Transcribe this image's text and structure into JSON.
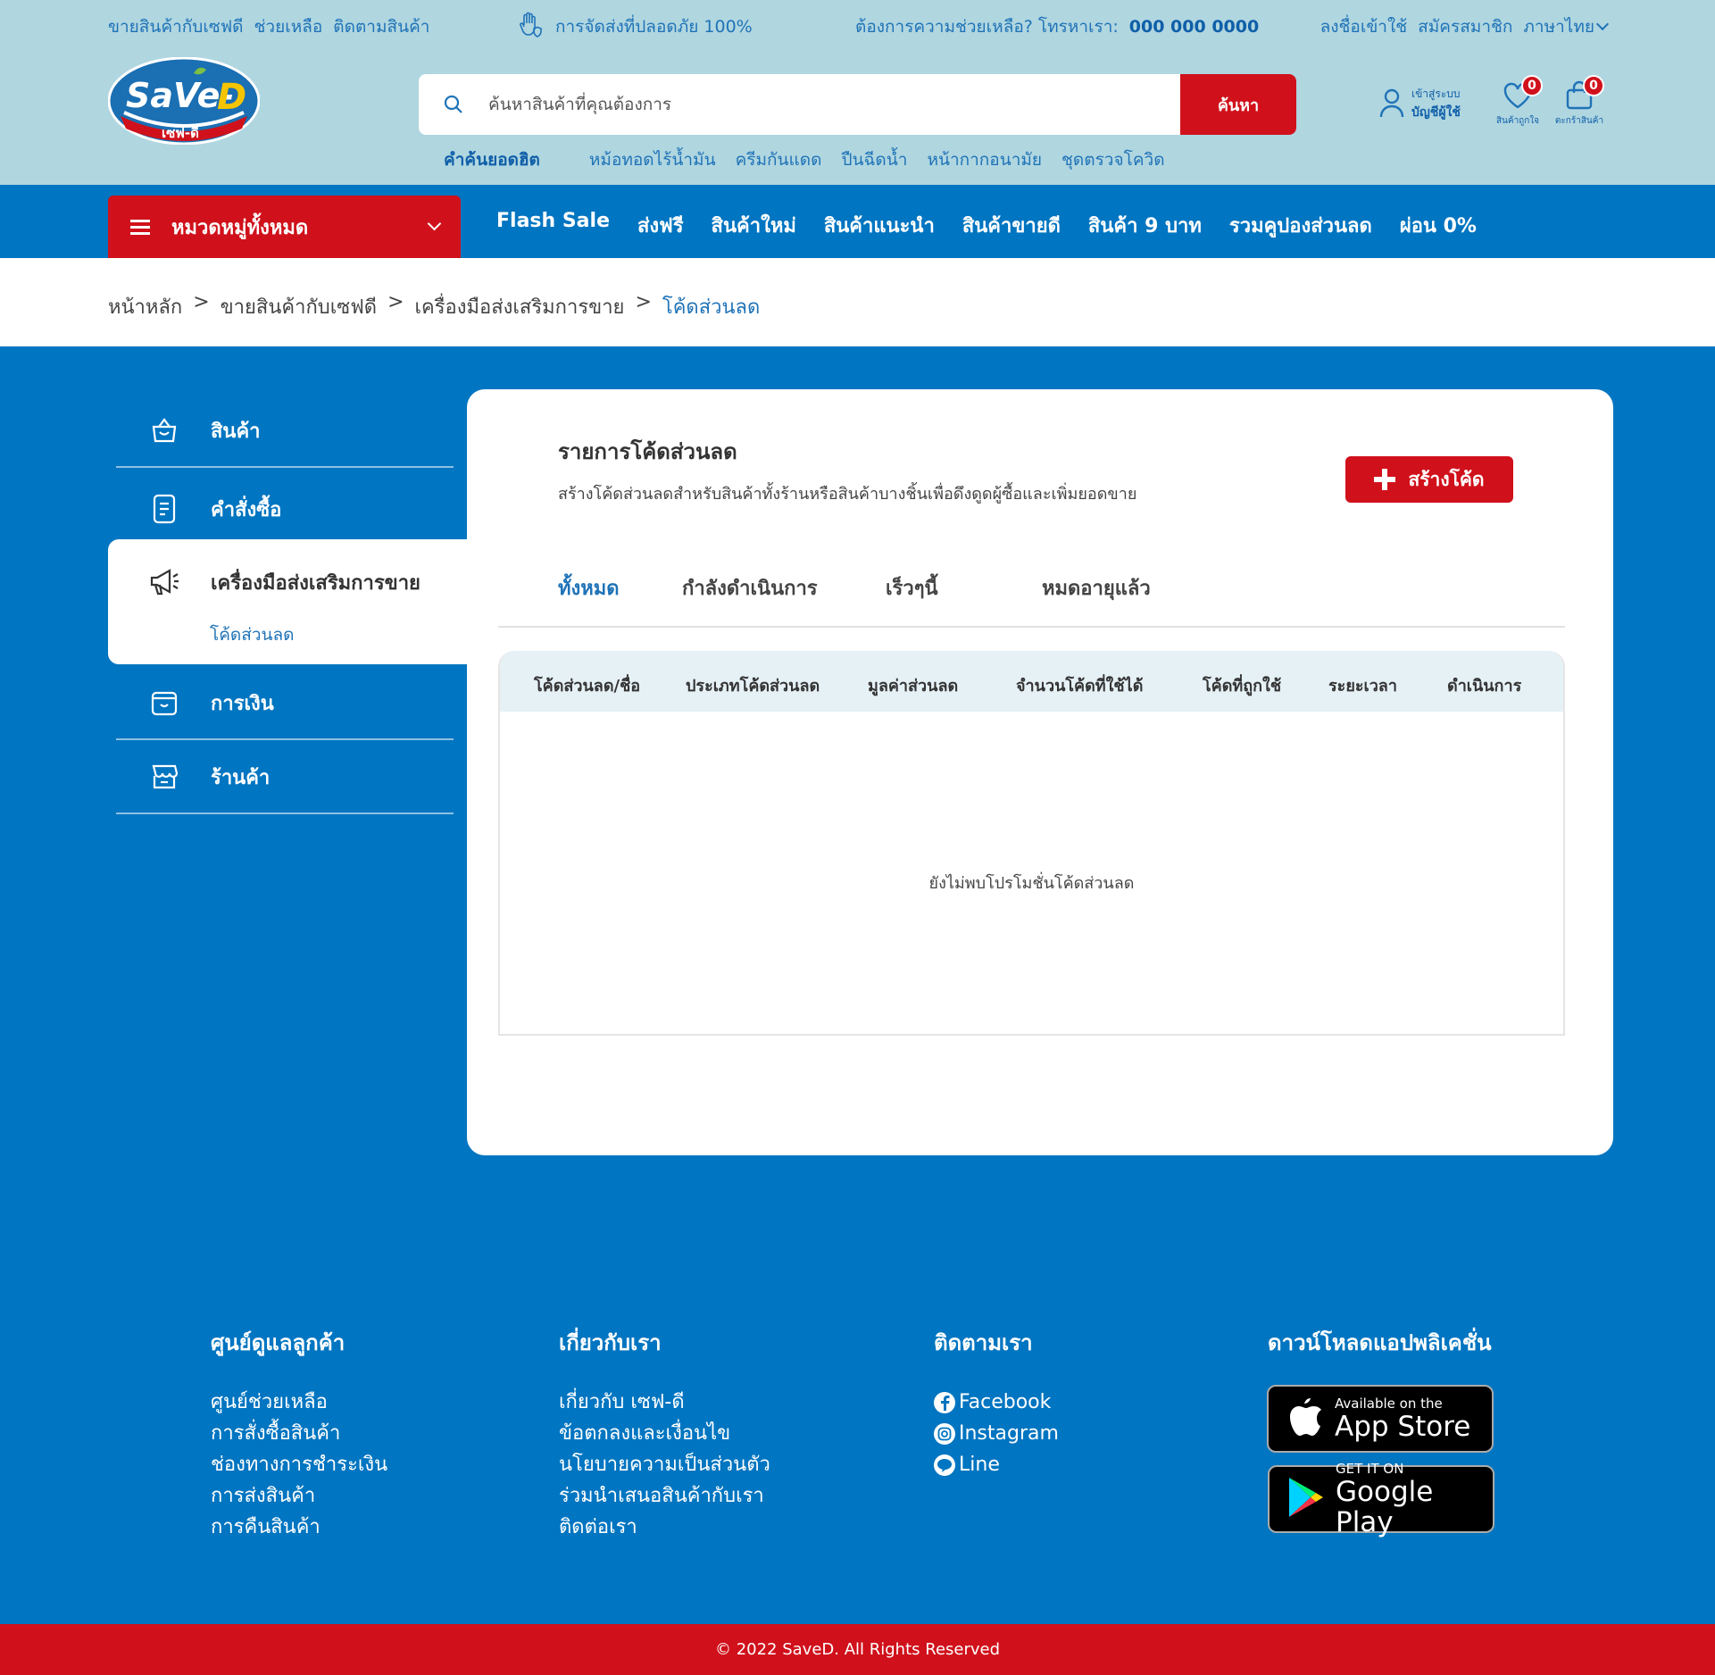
{
  "utility": {
    "seller_links": [
      "ขายสินค้ากับเซฟดี",
      "ช่วยเหลือ",
      "ติดตามสินค้า"
    ],
    "shipping_text": "การจัดส่งที่ปลอดภัย 100%",
    "help_prefix": "ต้องการความช่วยเหลือ? โทรหาเรา:",
    "help_phone": "000 000 0000",
    "login": "ลงชื่อเข้าใช้",
    "register": "สมัครสมาชิก",
    "language": "ภาษาไทย"
  },
  "logo": {
    "text": "SaVe-D",
    "sub": "เซฟ-ดี"
  },
  "search": {
    "placeholder": "ค้นหาสินค้าที่คุณต้องการ",
    "button": "ค้นหา"
  },
  "hot_keywords": {
    "title": "คำค้นยอดฮิต",
    "items": [
      "หม้อทอดไร้น้ำมัน",
      "ครีมกันแดด",
      "ปืนฉีดน้ำ",
      "หน้ากากอนามัย",
      "ชุดตรวจโควิด"
    ]
  },
  "account": {
    "line1": "เข้าสู่ระบบ",
    "line2": "บัญชีผู้ใช้"
  },
  "wishlist": {
    "label": "สินค้าถูกใจ",
    "count": "0"
  },
  "cart": {
    "label": "ตะกร้าสินค้า",
    "count": "0"
  },
  "nav": {
    "category_button": "หมวดหมู่ทั้งหมด",
    "links": [
      "Flash Sale",
      "ส่งฟรี",
      "สินค้าใหม่",
      "สินค้าแนะนำ",
      "สินค้าขายดี",
      "สินค้า 9 บาท",
      "รวมคูปองส่วนลด",
      "ผ่อน 0%"
    ]
  },
  "breadcrumb": [
    "หน้าหลัก",
    "ขายสินค้ากับเซฟดี",
    "เครื่องมือส่งเสริมการขาย",
    "โค้ดส่วนลด"
  ],
  "sidebar": {
    "items": [
      {
        "label": "สินค้า",
        "icon": "shopping-bag-icon"
      },
      {
        "label": "คำสั่งซื้อ",
        "icon": "document-icon"
      },
      {
        "label": "เครื่องมือส่งเสริมการขาย",
        "icon": "megaphone-icon",
        "sub": "โค้ดส่วนลด",
        "active": true
      },
      {
        "label": "การเงิน",
        "icon": "wallet-icon"
      },
      {
        "label": "ร้านค้า",
        "icon": "store-icon"
      }
    ]
  },
  "content": {
    "title": "รายการโค้ดส่วนลด",
    "description": "สร้างโค้ดส่วนลดสำหรับสินค้าทั้งร้านหรือสินค้าบางชิ้นเพื่อดึงดูดผู้ซื้อและเพิ่มยอดขาย",
    "create_button": "สร้างโค้ด",
    "tabs": [
      "ทั้งหมด",
      "กำลังดำเนินการ",
      "เร็วๆนี้",
      "หมดอายุแล้ว"
    ],
    "active_tab": 0,
    "columns": [
      "โค้ดส่วนลด/ชื่อ",
      "ประเภทโค้ดส่วนลด",
      "มูลค่าส่วนลด",
      "จำนวนโค้ดที่ใช้ได้",
      "โค้ดที่ถูกใช้",
      "ระยะเวลา",
      "ดำเนินการ"
    ],
    "empty_message": "ยังไม่พบโปรโมชั่นโค้ดส่วนลด"
  },
  "footer": {
    "customer_service": {
      "title": "ศูนย์ดูแลลูกค้า",
      "links": [
        "ศูนย์ช่วยเหลือ",
        "การสั่งซื้อสินค้า",
        "ช่องทางการชำระเงิน",
        "การส่งสินค้า",
        "การคืนสินค้า"
      ]
    },
    "about": {
      "title": "เกี่ยวกับเรา",
      "links": [
        "เกี่ยวกับ เซฟ-ดี",
        "ข้อตกลงและเงื่อนไข",
        "นโยบายความเป็นส่วนตัว",
        "ร่วมนำเสนอสินค้ากับเรา",
        "ติดต่อเรา"
      ]
    },
    "follow": {
      "title": "ติดตามเรา",
      "links": [
        "Facebook",
        "Instagram",
        "Line"
      ]
    },
    "apps": {
      "title": "ดาวน์โหลดแอปพลิเคชั่น",
      "app_store_small": "Available on the",
      "app_store_big": "App Store",
      "google_small": "GET IT ON",
      "google_big": "Google Play"
    },
    "copyright": "© 2022 SaveD. All Rights Reserved"
  },
  "colors": {
    "primary_blue": "#0075c1",
    "light_blue": "#b0d6e0",
    "red": "#d0111b",
    "link_blue": "#1f73b7"
  }
}
